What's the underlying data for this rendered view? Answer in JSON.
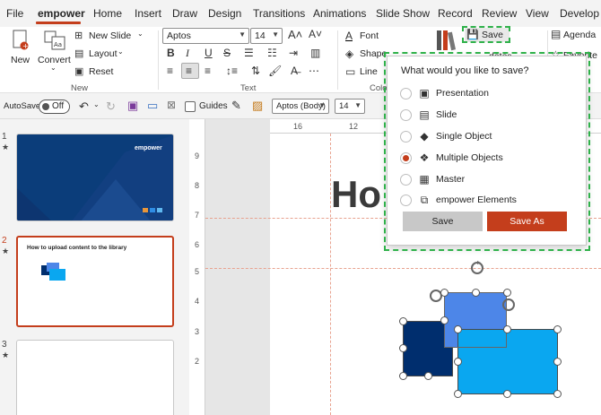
{
  "menubar": {
    "tabs": [
      "File",
      "empower",
      "Home",
      "Insert",
      "Draw",
      "Design",
      "Transitions",
      "Animations",
      "Slide Show",
      "Record",
      "Review",
      "View",
      "Develop"
    ],
    "active_tab": "empower"
  },
  "ribbon": {
    "new_label": "New",
    "convert_label": "Convert",
    "new_slide_label": "New Slide",
    "layout_label": "Layout",
    "reset_label": "Reset",
    "group_new": "New",
    "font_name": "Aptos",
    "font_size": "14",
    "group_text": "Text",
    "font_button_label": "Font",
    "shape_fill_label": "Shape Fill",
    "line_label": "Line",
    "group_color_partial": "Colo",
    "save_label": "Save",
    "updates_partial": "dates",
    "agenda_label": "Agenda",
    "favorite_partial": "Favorite"
  },
  "qat": {
    "autosave_label": "AutoSave",
    "autosave_state": "Off",
    "guides_label": "Guides",
    "font_name": "Aptos (Body)",
    "font_size": "14"
  },
  "slides": [
    {
      "number": "1",
      "brand": "empower"
    },
    {
      "number": "2",
      "title": "How to upload content to the library"
    },
    {
      "number": "3"
    }
  ],
  "editor": {
    "heading_partial": "Ho",
    "ruler_h": [
      "16",
      "12"
    ],
    "ruler_v": [
      "9",
      "8",
      "7",
      "6",
      "5",
      "4",
      "3",
      "2"
    ]
  },
  "save_popup": {
    "title": "What would you like to save?",
    "options": [
      {
        "label": "Presentation",
        "icon": "presentation-icon",
        "checked": false
      },
      {
        "label": "Slide",
        "icon": "slide-icon",
        "checked": false
      },
      {
        "label": "Single Object",
        "icon": "single-object-icon",
        "checked": false
      },
      {
        "label": "Multiple Objects",
        "icon": "multiple-objects-icon",
        "checked": true
      },
      {
        "label": "Master",
        "icon": "master-icon",
        "checked": false
      },
      {
        "label": "empower Elements",
        "icon": "empower-elements-icon",
        "checked": false
      }
    ],
    "save_button": "Save",
    "save_as_button": "Save As"
  },
  "colors": {
    "accent": "#c43e1c",
    "highlight": "#2fb14a",
    "navy": "#002e6e",
    "blue": "#4d86e8",
    "cyan": "#0aa7f0"
  }
}
